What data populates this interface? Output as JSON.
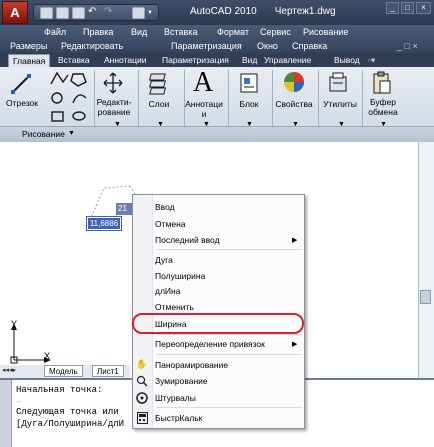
{
  "app": {
    "logo_letter": "A",
    "title": "AutoCAD 2010",
    "document": "Чертеж1.dwg"
  },
  "menu": {
    "row1": [
      "Файл",
      "Правка",
      "Вид",
      "Вставка",
      "Формат",
      "Сервис",
      "Рисование"
    ],
    "row2": [
      "Размеры",
      "Редактировать",
      "Параметризация",
      "Окно",
      "Справка"
    ]
  },
  "ribbon_tabs": [
    "Главная",
    "Вставка",
    "Аннотации",
    "Параметризация",
    "Вид",
    "Управление",
    "Вывод"
  ],
  "ribbon_tools": {
    "line": "Отрезок",
    "edit": "Редакти-\nрование",
    "layers": "Слои",
    "annotations_big_letter": "A",
    "annotations": "Аннотаци\nи",
    "block": "Блок",
    "properties": "Свойства",
    "utilities": "Утилиты",
    "clipboard": "Буфер\nобмена",
    "panel_label": "Рисование"
  },
  "drawing": {
    "dim_value": "11,6886",
    "dim_partial": "21",
    "ucs_y": "Y",
    "ucs_x": "X"
  },
  "model_tabs": [
    "Модель",
    "Лист1"
  ],
  "command_line": [
    "Начальная точка:",
    "Следующая точка или",
    "[Дуга/Полуширина/длИ"
  ],
  "context_menu": {
    "items": [
      {
        "label": "Ввод",
        "icon": "",
        "submenu": false
      },
      {
        "label": "Отмена",
        "icon": "",
        "submenu": false
      },
      {
        "label": "Последний ввод",
        "icon": "",
        "submenu": true
      },
      {
        "label": "Дуга",
        "icon": "",
        "submenu": false
      },
      {
        "label": "Полуширина",
        "icon": "",
        "submenu": false
      },
      {
        "label": "длИна",
        "icon": "",
        "submenu": false
      },
      {
        "label": "Отменить",
        "icon": "",
        "submenu": false
      },
      {
        "label": "Ширина",
        "icon": "",
        "submenu": false
      },
      {
        "label": "Переопределение привязок",
        "icon": "",
        "submenu": true
      },
      {
        "label": "Панорамирование",
        "icon": "pan-icon",
        "submenu": false
      },
      {
        "label": "Зумирование",
        "icon": "zoom-icon",
        "submenu": false
      },
      {
        "label": "Штурвалы",
        "icon": "steering-wheel-icon",
        "submenu": false
      },
      {
        "label": "БыстрКальк",
        "icon": "calculator-icon",
        "submenu": false
      }
    ],
    "highlighted_item": "Ширина",
    "highlight_color": "#d1252e"
  }
}
